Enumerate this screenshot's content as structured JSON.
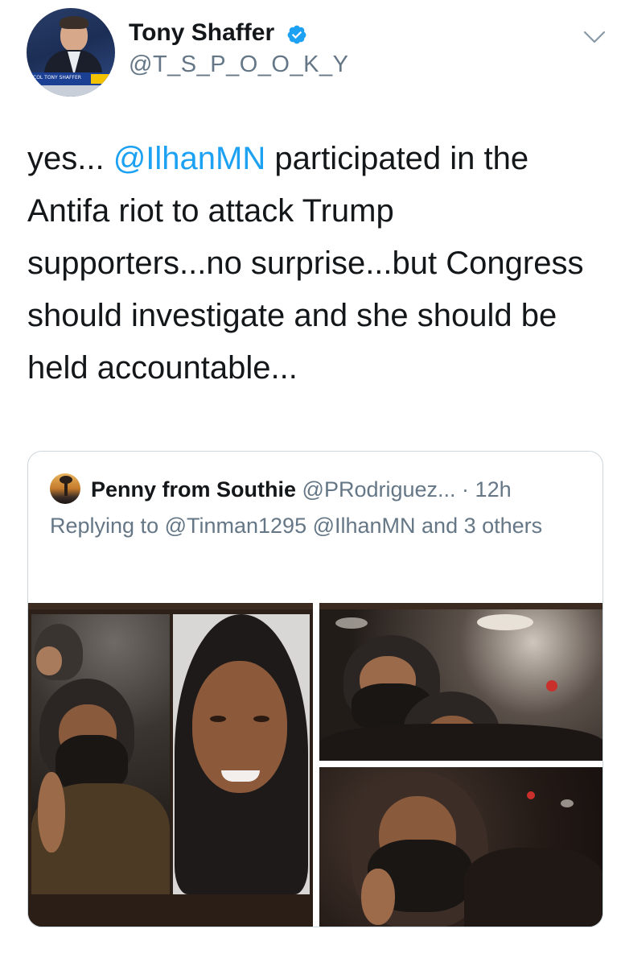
{
  "tweet": {
    "author_name": "Tony Shaffer",
    "author_handle": "@T_S_P_O_O_K_Y",
    "avatar_chyron": "COL TONY SHAFFER",
    "avatar_tag": "ON TV",
    "verified": true,
    "text_parts": [
      "yes... ",
      "@IlhanMN",
      " participated in the Antifa riot to attack Trump supporters...no surprise...but Congress should investigate and she should be held accountable..."
    ]
  },
  "quoted_tweet": {
    "author_name": "Penny from Southie",
    "author_handle": "@PRodriguez...",
    "separator": " · ",
    "time": "12h",
    "reply_line": "Replying to @Tinman1295 @IlhanMN and 3 others"
  },
  "icons": {
    "verified": "verified-badge-icon",
    "menu": "chevron-down-icon"
  },
  "colors": {
    "link": "#1da1f2",
    "secondary_text": "#657786",
    "primary_text": "#14171a",
    "border": "#ccd6dd",
    "verified": "#1da1f2"
  }
}
